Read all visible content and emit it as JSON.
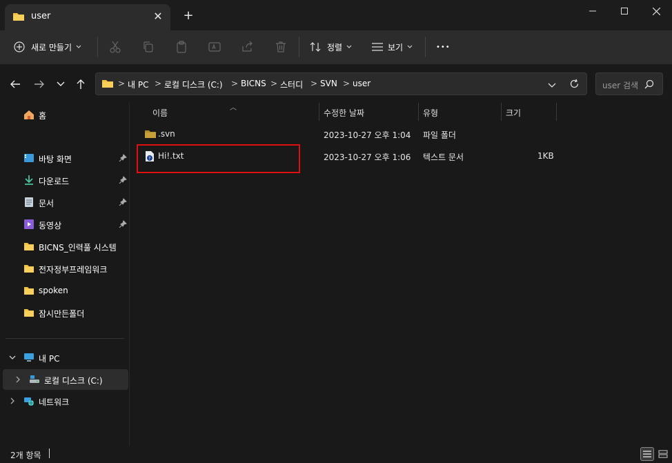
{
  "tab": {
    "title": "user",
    "close_glyph": "✕",
    "new_tab_glyph": "+"
  },
  "toolbar": {
    "new_label": "새로 만들기",
    "sort_label": "정렬",
    "view_label": "보기",
    "more_glyph": "•••"
  },
  "address": {
    "crumbs": [
      "내 PC",
      "로컬 디스크 (C:)",
      "BICNS",
      "스터디",
      "SVN",
      "user"
    ],
    "separator": ">",
    "search_placeholder": "user 검색"
  },
  "sidebar": {
    "home": "홈",
    "quick": [
      {
        "label": "바탕 화면",
        "icon": "desktop-icon",
        "pinned": true
      },
      {
        "label": "다운로드",
        "icon": "download-icon",
        "pinned": true
      },
      {
        "label": "문서",
        "icon": "document-icon",
        "pinned": true
      },
      {
        "label": "동영상",
        "icon": "video-icon",
        "pinned": true
      },
      {
        "label": "BICNS_인력풀 시스템",
        "icon": "folder-icon",
        "pinned": false
      },
      {
        "label": "전자정부프레임워크",
        "icon": "folder-icon",
        "pinned": false
      },
      {
        "label": "spoken",
        "icon": "folder-icon",
        "pinned": false
      },
      {
        "label": "잠시만든폴더",
        "icon": "folder-icon",
        "pinned": false
      }
    ],
    "this_pc": "내 PC",
    "local_disk": "로컬 디스크 (C:)",
    "network": "네트워크"
  },
  "columns": [
    "이름",
    "수정한 날짜",
    "유형",
    "크기"
  ],
  "files": [
    {
      "name": ".svn",
      "modified": "2023-10-27 오후 1:04",
      "type": "파일 폴더",
      "size": "",
      "icon": "folder-icon"
    },
    {
      "name": "Hi!.txt",
      "modified": "2023-10-27 오후 1:06",
      "type": "텍스트 문서",
      "size": "1KB",
      "icon": "text-file-icon"
    }
  ],
  "status": {
    "item_count": "2개 항목"
  },
  "colors": {
    "folder": "#f3c343",
    "highlight": "#e01010",
    "background": "#191919"
  }
}
